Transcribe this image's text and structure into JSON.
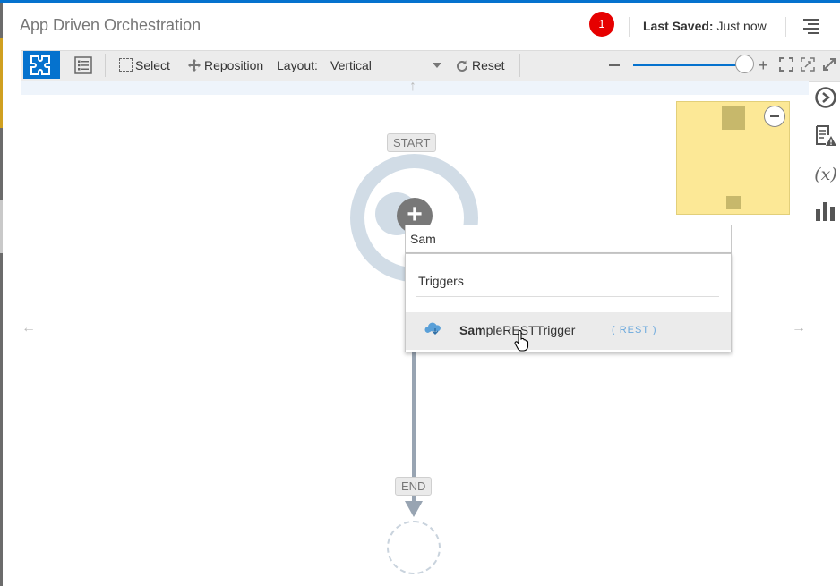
{
  "header": {
    "title": "App Driven Orchestration",
    "notification_count": "1",
    "last_saved_label": "Last Saved:",
    "last_saved_value": "Just now",
    "menu_icon": "hamburger-menu-icon"
  },
  "toolbar": {
    "mode_canvas_icon": "puzzle-icon",
    "mode_list_icon": "list-icon",
    "select_label": "Select",
    "reposition_label": "Reposition",
    "layout_label": "Layout:",
    "layout_value": "Vertical",
    "reset_label": "Reset",
    "zoom_level_fraction": 0.97,
    "icons": [
      "zoom-out-icon",
      "zoom-in-icon",
      "fit-screen-icon",
      "fit-selection-icon",
      "expand-icon"
    ]
  },
  "canvas": {
    "start_label": "START",
    "end_label": "END",
    "add_trigger_icon": "plus-icon"
  },
  "search": {
    "query": "Sam",
    "section_heading": "Triggers",
    "results": [
      {
        "match": "Sam",
        "rest": "pleRESTTrigger",
        "type": "( REST )"
      }
    ]
  },
  "right_rail": {
    "icons": [
      "run-icon",
      "issues-icon",
      "variables-icon",
      "analytics-icon"
    ],
    "variables_glyph": "(x)"
  },
  "colors": {
    "accent": "#0572ce",
    "notification": "#e60000",
    "minimap": "#fce896",
    "flow_line": "#98a4b2"
  }
}
